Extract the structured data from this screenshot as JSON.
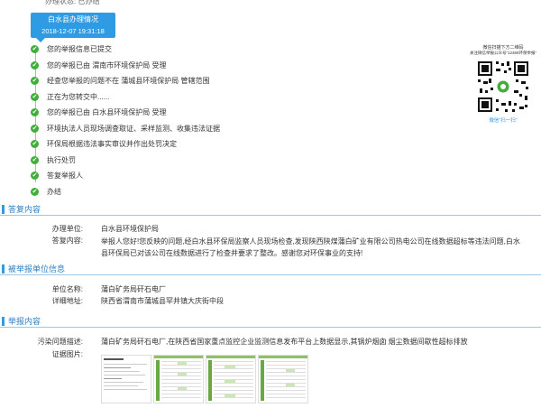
{
  "status_card": {
    "title": "白水县办理情况",
    "datetime": "2018-12-07 19:31:18"
  },
  "timeline": [
    "您的举报信息已提交",
    "您的举报已由 渭南市环境保护局 受理",
    "经查您举报的问题不在 蒲城县环境保护局 管辖范围",
    "正在为您转交中......",
    "您的举报已由 白水县环境保护局 受理",
    "环境执法人员现场调查取证、采样监测、收集违法证据",
    "环保局根据违法事实审议并作出处罚决定",
    "执行处罚",
    "答复举报人",
    "办结"
  ],
  "qr": {
    "caption_line1": "微信扫描下方二维码",
    "caption_line2": "关注微信举报公众号“12369环保举报”",
    "caption_line3": "微信“扫一扫”"
  },
  "reply_section": {
    "title": "答复内容",
    "unit_label": "办理单位:",
    "unit_value": "白水县环境保护局",
    "content_label": "答复内容:",
    "content_value": "举报人您好!您反映的问题,经白水县环保局监察人员现场检查,发现陕西陕煤蒲白矿业有限公司热电公司在线数据超标等违法问题,白水县环保局已对该公司在线数据进行了检查并要求了整改。感谢您对环保事业的支持!"
  },
  "reported_unit_section": {
    "title": "被举报单位信息",
    "name_label": "单位名称:",
    "name_value": "蒲白矿务局矸石电厂",
    "address_label": "详细地址:",
    "address_value": "陕西省渭南市蒲城县罕井镇大庆街中段"
  },
  "report_section": {
    "title": "举报内容",
    "desc_label": "污染问题描述:",
    "desc_value": "蒲白矿务局矸石电厂,在陕西省国家重点监控企业监测信息发布平台上数据显示,其锅炉烟囱 烟尘数据间歇性超标排放",
    "evidence_label": "证据图片:"
  },
  "colors": {
    "accent_blue": "#2f9be3",
    "section_blue": "#2f7fc0",
    "check_green": "#3fae3a"
  }
}
